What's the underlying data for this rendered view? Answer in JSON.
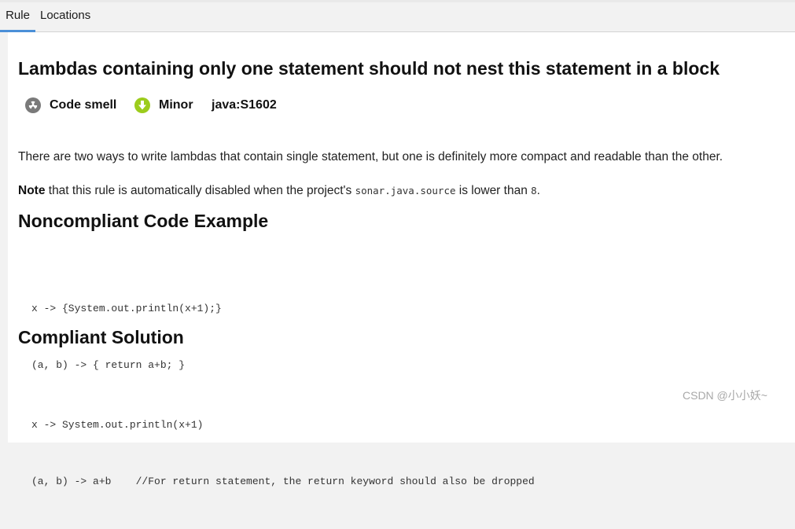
{
  "tabs": [
    {
      "label": "Rule",
      "active": true
    },
    {
      "label": "Locations",
      "active": false
    }
  ],
  "rule": {
    "title": "Lambdas containing only one statement should not nest this statement in a block",
    "type": {
      "label": "Code smell",
      "icon": "radiation-icon",
      "color": "#7a7a7a"
    },
    "severity": {
      "label": "Minor",
      "icon": "arrow-down-circle-icon",
      "color": "#9ccc1c"
    },
    "key": "java:S1602"
  },
  "description": {
    "intro": "There are two ways to write lambdas that contain single statement, but one is definitely more compact and readable than the other.",
    "note_label": "Note",
    "note_text_1": " that this rule is automatically disabled when the project's ",
    "note_code_1": "sonar.java.source",
    "note_text_2": " is lower than ",
    "note_code_2": "8",
    "note_text_3": "."
  },
  "noncompliant": {
    "heading": "Noncompliant Code Example",
    "lines": [
      "x -> {System.out.println(x+1);}",
      "(a, b) -> { return a+b; }"
    ]
  },
  "compliant": {
    "heading": "Compliant Solution",
    "lines": [
      "x -> System.out.println(x+1)",
      "(a, b) -> a+b    //For return statement, the return keyword should also be dropped"
    ]
  },
  "watermark": "CSDN @小小妖~"
}
